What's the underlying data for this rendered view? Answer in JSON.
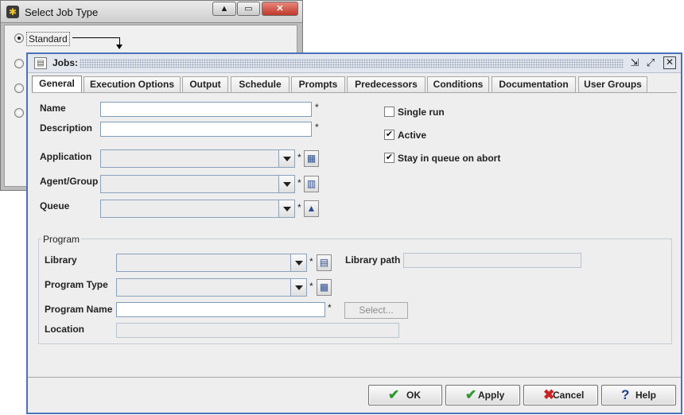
{
  "select_job_type": {
    "title": "Select Job Type",
    "option_standard": "Standard"
  },
  "jobs": {
    "title": "Jobs:",
    "tabs": [
      "General",
      "Execution Options",
      "Output",
      "Schedule",
      "Prompts",
      "Predecessors",
      "Conditions",
      "Documentation",
      "User Groups"
    ],
    "fields": {
      "name": "Name",
      "description": "Description",
      "application": "Application",
      "agent_group": "Agent/Group",
      "queue": "Queue",
      "required_mark": "*"
    },
    "checkboxes": {
      "single_run": "Single run",
      "active": "Active",
      "stay_in_queue": "Stay in queue on abort"
    },
    "program": {
      "group_title": "Program",
      "library": "Library",
      "library_path": "Library path",
      "program_type": "Program Type",
      "program_name": "Program Name",
      "location": "Location",
      "select_button": "Select..."
    },
    "buttons": {
      "ok": "OK",
      "apply": "Apply",
      "cancel": "Cancel",
      "help": "Help"
    }
  }
}
